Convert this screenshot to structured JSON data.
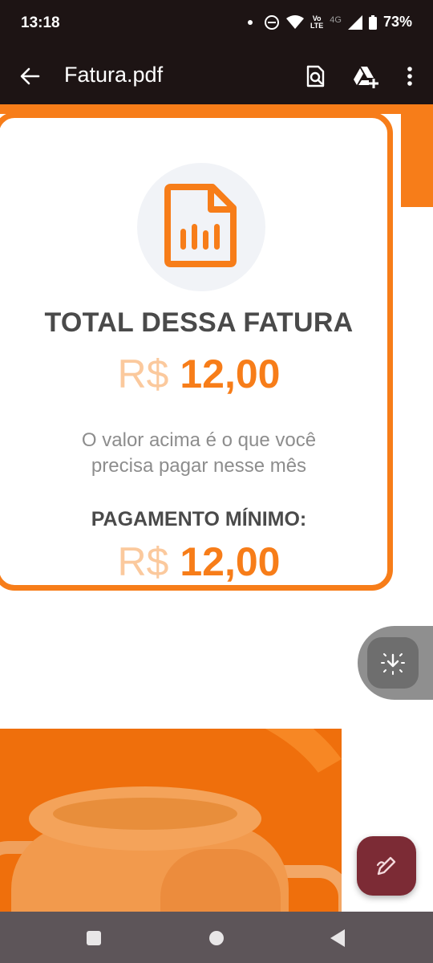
{
  "status_bar": {
    "time": "13:18",
    "volte_top": "Vo",
    "volte_bottom": "LTE",
    "network": "4G",
    "battery": "73%"
  },
  "app_bar": {
    "title": "Fatura.pdf",
    "icons": [
      "back-arrow-icon",
      "find-in-page-icon",
      "add-to-drive-icon",
      "more-vert-icon"
    ]
  },
  "invoice": {
    "total_title": "TOTAL DESSA FATURA",
    "total_currency": "R$",
    "total_value": "12,00",
    "description_line1": "O valor acima é o que você",
    "description_line2": "precisa pagar nesse mês",
    "min_title": "PAGAMENTO MÍNIMO:",
    "min_currency": "R$",
    "min_value": "12,00"
  },
  "colors": {
    "brand_orange": "#f77d19",
    "light_orange": "#fbc99d",
    "app_bar_bg": "#1d1414",
    "edit_fab_bg": "#7c2b35",
    "nav_bar_bg": "#5d5559"
  },
  "fabs": {
    "download_icon": "download-icon",
    "edit_icon": "edit-pen-icon"
  },
  "nav": [
    "recent-apps-icon",
    "home-icon",
    "back-icon"
  ]
}
